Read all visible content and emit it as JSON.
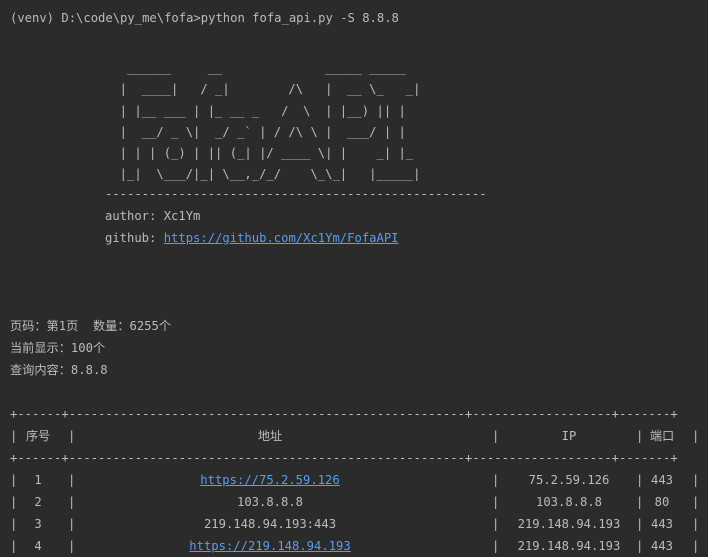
{
  "command": {
    "prompt": "(venv) D:\\code\\py_me\\fofa>",
    "text": "python fofa_api.py -S 8.8.8"
  },
  "banner": {
    "ascii_lines": [
      "   ______     __              _____ _____",
      "  |  ____|   / _|        /\\   |  __ \\_   _|",
      "  | |__ ___ | |_ __ _   /  \\  | |__) || |",
      "  |  __/ _ \\|  _/ _` | / /\\ \\ |  ___/ | |",
      "  | | | (_) | || (_| |/ ____ \\| |    _| |_",
      "  |_|  \\___/|_| \\__,_/_/    \\_\\_|   |_____|"
    ],
    "divider": "----------------------------------------------------",
    "author_label": "author: ",
    "author_value": "Xc1Ym",
    "github_label": "github: ",
    "github_url": "https://github.com/Xc1Ym/FofaAPI"
  },
  "summary": {
    "page_line": "页码：第1页  数量：6255个",
    "shown_line": "当前显示：100个",
    "query_line": "查询内容：8.8.8"
  },
  "table": {
    "border_line": "+------+------------------------------------------------------+-------------------+-------+",
    "headers": [
      "序号",
      "地址",
      "IP",
      "端口"
    ],
    "rows": [
      {
        "index": "1",
        "address": "https://75.2.59.126",
        "address_is_link": true,
        "ip": "75.2.59.126",
        "port": "443"
      },
      {
        "index": "2",
        "address": "103.8.8.8",
        "address_is_link": false,
        "ip": "103.8.8.8",
        "port": "80"
      },
      {
        "index": "3",
        "address": "219.148.94.193:443",
        "address_is_link": false,
        "ip": "219.148.94.193",
        "port": "443"
      },
      {
        "index": "4",
        "address": "https://219.148.94.193",
        "address_is_link": true,
        "ip": "219.148.94.193",
        "port": "443"
      }
    ]
  },
  "colors": {
    "background": "#2b2b2b",
    "text": "#bbbbbb",
    "link": "#589df6"
  }
}
